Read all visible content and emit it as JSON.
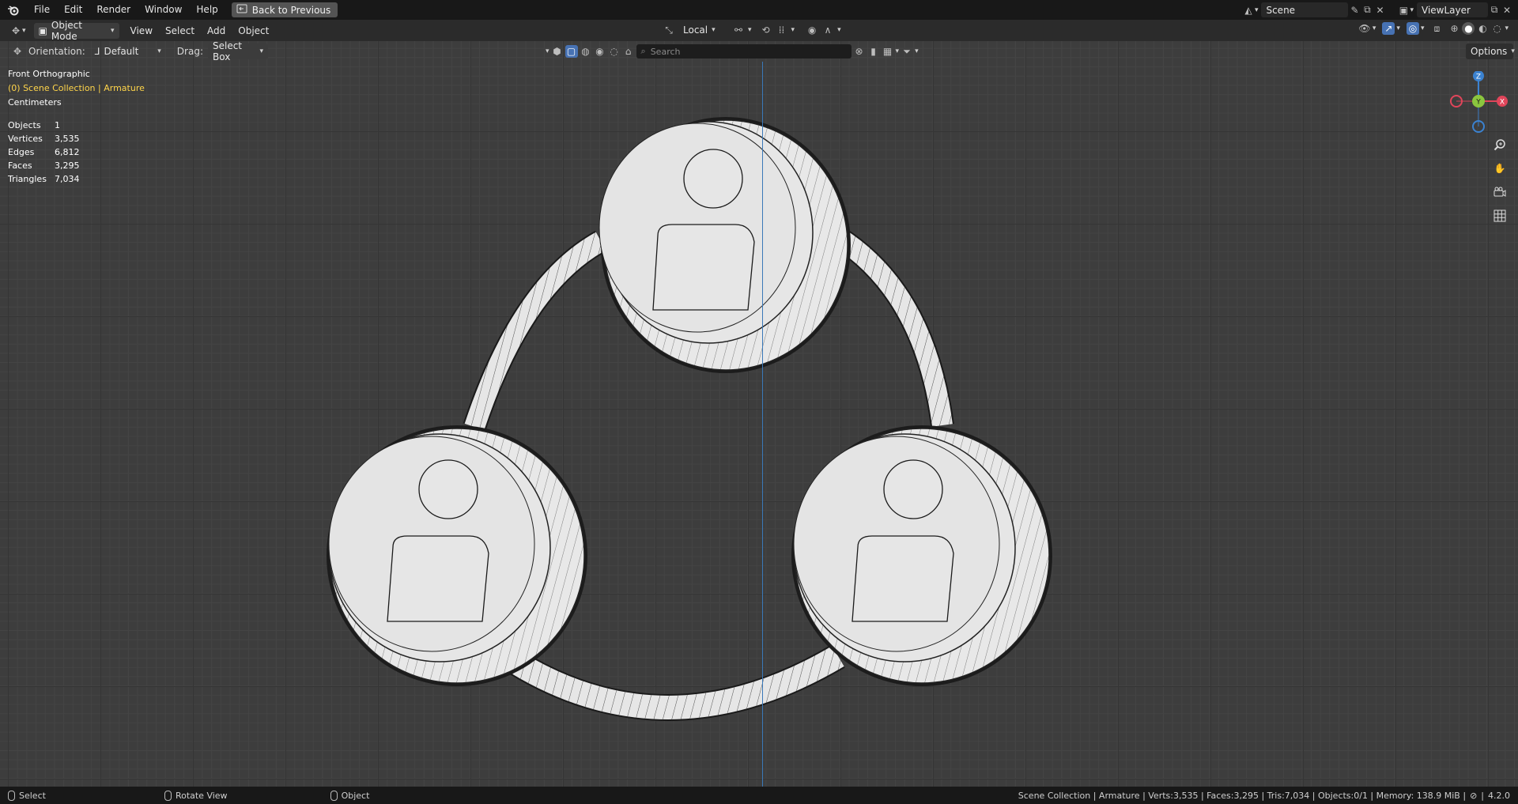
{
  "menu": {
    "file": "File",
    "edit": "Edit",
    "render": "Render",
    "window": "Window",
    "help": "Help",
    "back": "Back to Previous"
  },
  "topright": {
    "scene": "Scene",
    "viewlayer": "ViewLayer"
  },
  "header": {
    "mode": "Object Mode",
    "view": "View",
    "select": "Select",
    "add": "Add",
    "object": "Object",
    "transform_orientation": "Local",
    "options": "Options"
  },
  "toolsettings": {
    "orientation_label": "Orientation:",
    "orientation_value": "Default",
    "drag_label": "Drag:",
    "drag_value": "Select Box"
  },
  "search": {
    "placeholder": "Search"
  },
  "viewport": {
    "view_name": "Front Orthographic",
    "collection": "(0) Scene Collection | Armature",
    "units": "Centimeters",
    "stats": [
      {
        "key": "Objects",
        "value": "1"
      },
      {
        "key": "Vertices",
        "value": "3,535"
      },
      {
        "key": "Edges",
        "value": "6,812"
      },
      {
        "key": "Faces",
        "value": "3,295"
      },
      {
        "key": "Triangles",
        "value": "7,034"
      }
    ]
  },
  "gizmo": {
    "z": "Z",
    "y": "Y",
    "x": "X"
  },
  "status": {
    "select": "Select",
    "rotate": "Rotate View",
    "object": "Object",
    "info": "Scene Collection | Armature | Verts:3,535 | Faces:3,295 | Tris:7,034 | Objects:0/1 | Memory: 138.9 MiB |",
    "version": "4.2.0"
  },
  "colors": {
    "axis_z": "#3a78b8",
    "gizmo_x": "#e0455a",
    "gizmo_y": "#8bc63e",
    "gizmo_z": "#3b82d0",
    "collection_text": "#ffd54a"
  }
}
